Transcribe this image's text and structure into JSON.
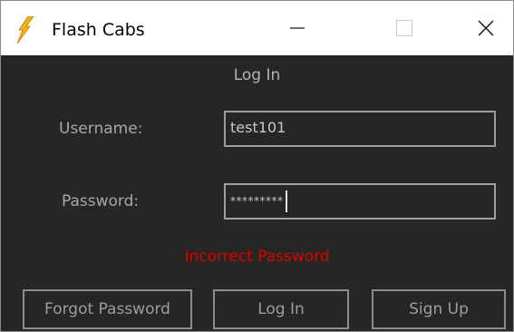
{
  "window": {
    "title": "Flash Cabs",
    "icon": "lightning-bolt-icon",
    "controls": [
      "minimize-icon",
      "maximize-icon",
      "close-icon"
    ]
  },
  "form": {
    "heading": "Log In",
    "username_label": "Username:",
    "username_value": "test101",
    "password_label": "Password:",
    "password_value": "*********",
    "error": "Incorrect Password"
  },
  "buttons": {
    "forgot_password": "Forgot Password",
    "log_in": "Log In",
    "sign_up": "Sign Up"
  },
  "colors": {
    "background": "#262624",
    "error": "#d80000",
    "text": "#a8a8a8"
  }
}
